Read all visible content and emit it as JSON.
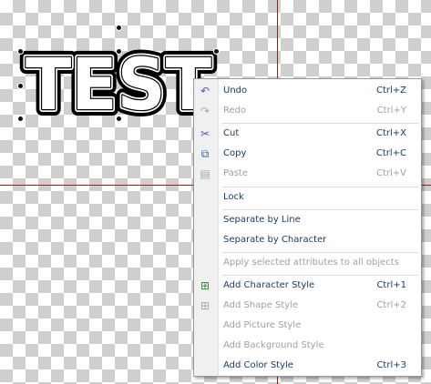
{
  "canvas": {
    "text_object": {
      "text": "TEST"
    }
  },
  "context_menu": {
    "items": [
      {
        "label": "Undo",
        "shortcut": "Ctrl+Z",
        "enabled": true,
        "icon": "undo-icon"
      },
      {
        "label": "Redo",
        "shortcut": "Ctrl+Y",
        "enabled": false,
        "icon": "redo-icon"
      },
      {
        "label": "Cut",
        "shortcut": "Ctrl+X",
        "enabled": true,
        "icon": "scissors-icon"
      },
      {
        "label": "Copy",
        "shortcut": "Ctrl+C",
        "enabled": true,
        "icon": "copy-icon"
      },
      {
        "label": "Paste",
        "shortcut": "Ctrl+V",
        "enabled": false,
        "icon": "paste-icon"
      },
      {
        "label": "Lock",
        "shortcut": "",
        "enabled": true,
        "icon": ""
      },
      {
        "label": "Separate by Line",
        "shortcut": "",
        "enabled": true,
        "icon": ""
      },
      {
        "label": "Separate by Character",
        "shortcut": "",
        "enabled": true,
        "icon": ""
      },
      {
        "label": "Apply selected attributes to all objects",
        "shortcut": "",
        "enabled": false,
        "icon": ""
      },
      {
        "label": "Add Character Style",
        "shortcut": "Ctrl+1",
        "enabled": true,
        "icon": "add-character-style-icon"
      },
      {
        "label": "Add Shape Style",
        "shortcut": "Ctrl+2",
        "enabled": false,
        "icon": "add-shape-style-icon"
      },
      {
        "label": "Add Picture Style",
        "shortcut": "",
        "enabled": false,
        "icon": ""
      },
      {
        "label": "Add Background Style",
        "shortcut": "",
        "enabled": false,
        "icon": ""
      },
      {
        "label": "Add Color Style",
        "shortcut": "Ctrl+3",
        "enabled": true,
        "icon": ""
      }
    ]
  },
  "colors": {
    "guide_line": "#9b1c1c",
    "menu_text": "#1b3a66",
    "disabled_text": "#a0a0a0"
  }
}
